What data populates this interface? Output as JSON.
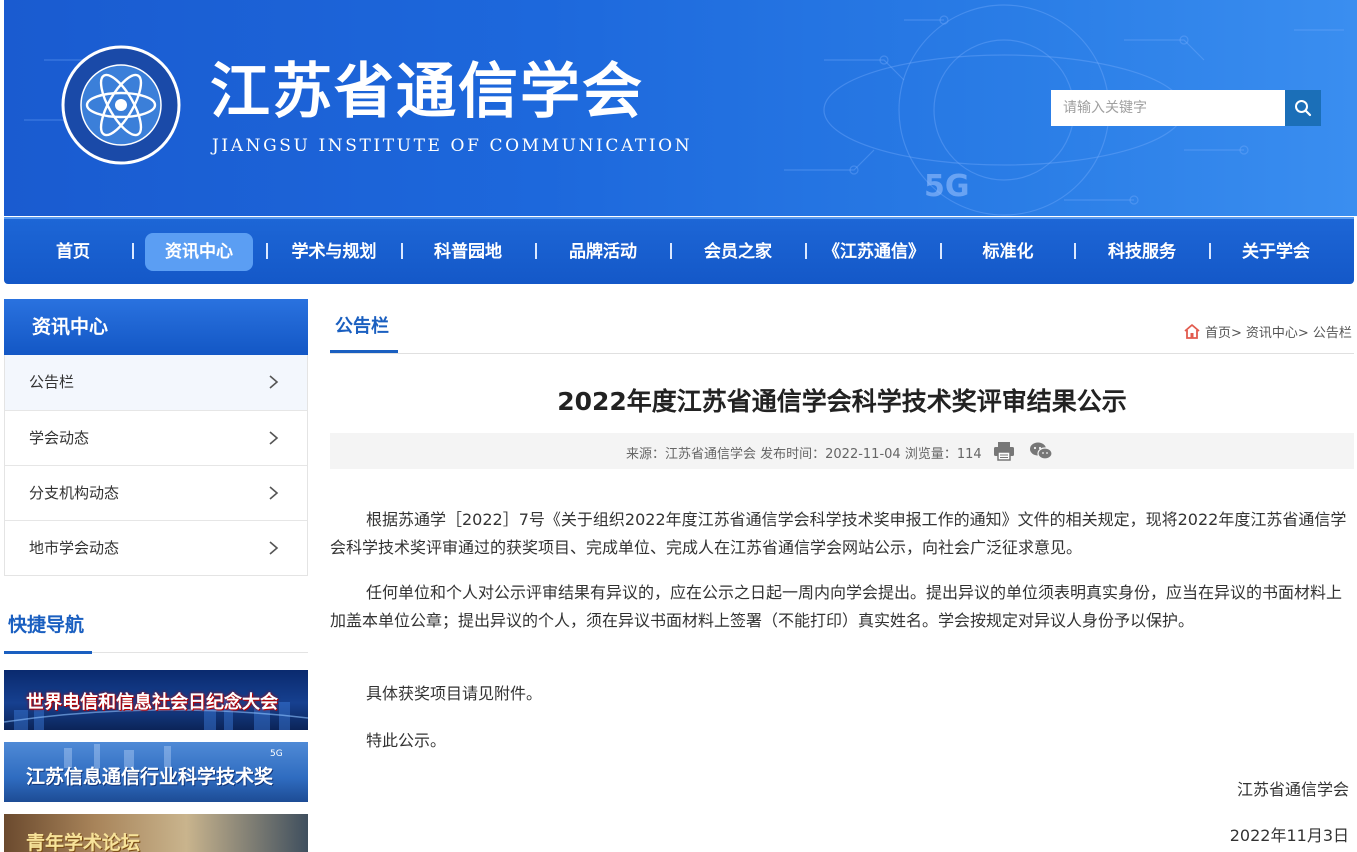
{
  "header": {
    "title": "江苏省通信学会",
    "subtitle": "JIANGSU INSTITUTE OF COMMUNICATION",
    "search_placeholder": "请输入关键字",
    "deco_label": "5G"
  },
  "nav": {
    "items": [
      "首页",
      "资讯中心",
      "学术与规划",
      "科普园地",
      "品牌活动",
      "会员之家",
      "《江苏通信》",
      "标准化",
      "科技服务",
      "关于学会"
    ],
    "active": "资讯中心"
  },
  "sidebar": {
    "title": "资讯中心",
    "items": [
      "公告栏",
      "学会动态",
      "分支机构动态",
      "地市学会动态"
    ],
    "quick_nav_title": "快捷导航",
    "banners": [
      "世界电信和信息社会日纪念大会",
      "江苏信息通信行业科学技术奖",
      "青年学术论坛"
    ],
    "banner2_badge": "5G"
  },
  "main": {
    "tab_title": "公告栏",
    "breadcrumb": [
      "首页>",
      "资讯中心>",
      "公告栏"
    ],
    "article": {
      "title": "2022年度江苏省通信学会科学技术奖评审结果公示",
      "meta": "来源：江苏省通信学会 发布时间：2022-11-04 浏览量：114",
      "paragraphs": [
        "根据苏通学［2022］7号《关于组织2022年度江苏省通信学会科学技术奖申报工作的通知》文件的相关规定，现将2022年度江苏省通信学会科学技术奖评审通过的获奖项目、完成单位、完成人在江苏省通信学会网站公示，向社会广泛征求意见。",
        "任何单位和个人对公示评审结果有异议的，应在公示之日起一周内向学会提出。提出异议的单位须表明真实身份，应当在异议的书面材料上加盖本单位公章；提出异议的个人，须在异议书面材料上签署（不能打印）真实姓名。学会按规定对异议人身份予以保护。",
        "具体获奖项目请见附件。",
        "特此公示。"
      ],
      "signature_org": "江苏省通信学会",
      "signature_date": "2022年11月3日"
    }
  },
  "colors": {
    "brand_blue": "#1a5fc0",
    "nav_active": "#5b9ef3",
    "search_button": "#1b6fb8"
  }
}
